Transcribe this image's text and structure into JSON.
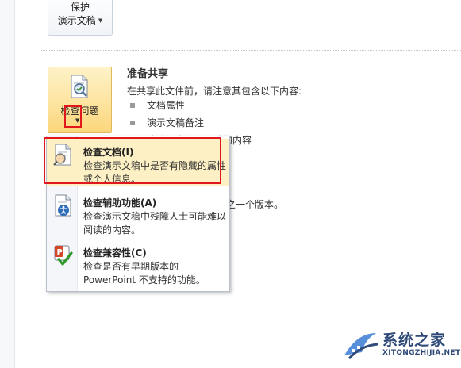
{
  "protect": {
    "line1": "保护",
    "line2": "演示文稿"
  },
  "inspect": {
    "label": "检查问题"
  },
  "share": {
    "title": "准备共享",
    "desc": "在共享此文件前，请注意其包含以下内容:",
    "bullets": [
      "文档属性",
      "演示文稿备注",
      "残障人士难以阅读的内容"
    ]
  },
  "versions": {
    "partial": "之一个版本。"
  },
  "menu": {
    "items": [
      {
        "title": "检查文档(I)",
        "desc": "检查演示文稿中是否有隐藏的属性或个人信息。"
      },
      {
        "title": "检查辅助功能(A)",
        "desc": "检查演示文稿中残障人士可能难以阅读的内容。"
      },
      {
        "title": "检查兼容性(C)",
        "desc": "检查是否有早期版本的 PowerPoint 不支持的功能。"
      }
    ]
  },
  "watermark": {
    "main": "系统之家",
    "sub": "XITONGZHIJIA.NET"
  },
  "colors": {
    "highlight": "#fdf0c4",
    "button_gradient_top": "#fff2c7",
    "button_gradient_bottom": "#fcd67b",
    "annotation_red": "#e0171d",
    "watermark_blue": "#2f4a78"
  },
  "icons": {
    "inspect": "document-inspect-icon",
    "doc_inspector": "document-magnifier-icon",
    "accessibility": "accessibility-icon",
    "compatibility": "compatibility-check-icon"
  }
}
